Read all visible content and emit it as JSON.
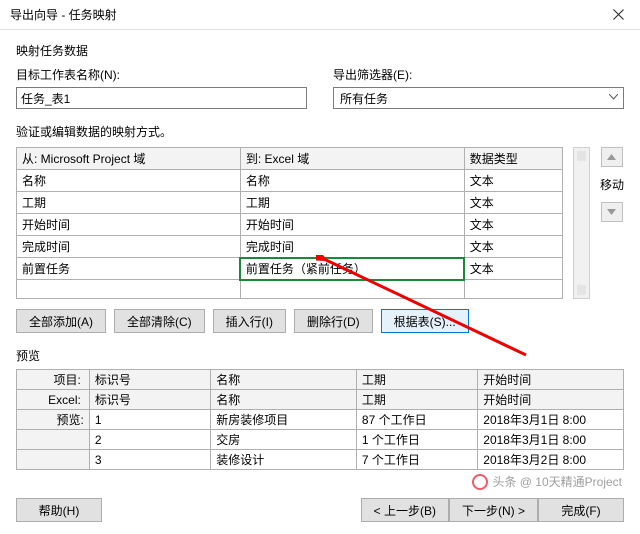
{
  "window": {
    "title": "导出向导 - 任务映射"
  },
  "section_map_data": "映射任务数据",
  "target": {
    "label": "目标工作表名称(N):",
    "value": "任务_表1"
  },
  "filter": {
    "label": "导出筛选器(E):",
    "value": "所有任务"
  },
  "verify_label": "验证或编辑数据的映射方式。",
  "mapping": {
    "headers": {
      "from": "从: Microsoft Project 域",
      "to": "到: Excel 域",
      "type": "数据类型"
    },
    "rows": [
      {
        "from": "名称",
        "to": "名称",
        "type": "文本"
      },
      {
        "from": "工期",
        "to": "工期",
        "type": "文本"
      },
      {
        "from": "开始时间",
        "to": "开始时间",
        "type": "文本"
      },
      {
        "from": "完成时间",
        "to": "完成时间",
        "type": "文本"
      },
      {
        "from": "前置任务",
        "to": "前置任务（紧前任务）",
        "type": "文本"
      }
    ]
  },
  "move_label": "移动",
  "buttons": {
    "add_all": "全部添加(A)",
    "clear_all": "全部清除(C)",
    "insert_row": "插入行(I)",
    "delete_row": "删除行(D)",
    "by_table": "根据表(S)..."
  },
  "preview": {
    "label": "预览",
    "row_labels": {
      "project": "项目:",
      "excel": "Excel:",
      "preview": "预览:"
    },
    "project": [
      "标识号",
      "名称",
      "工期",
      "开始时间"
    ],
    "excel": [
      "标识号",
      "名称",
      "工期",
      "开始时间"
    ],
    "data": [
      {
        "id": "1",
        "name": "新房装修项目",
        "dur": "87 个工作日",
        "start": "2018年3月1日 8:00"
      },
      {
        "id": "2",
        "name": "交房",
        "dur": "1 个工作日",
        "start": "2018年3月1日 8:00"
      },
      {
        "id": "3",
        "name": "装修设计",
        "dur": "7 个工作日",
        "start": "2018年3月2日 8:00"
      }
    ]
  },
  "footer": {
    "help": "帮助(H)",
    "back": "< 上一步(B)",
    "next": "下一步(N) >",
    "finish": "完成(F)"
  },
  "watermark": "头条 @ 10天精通Project"
}
